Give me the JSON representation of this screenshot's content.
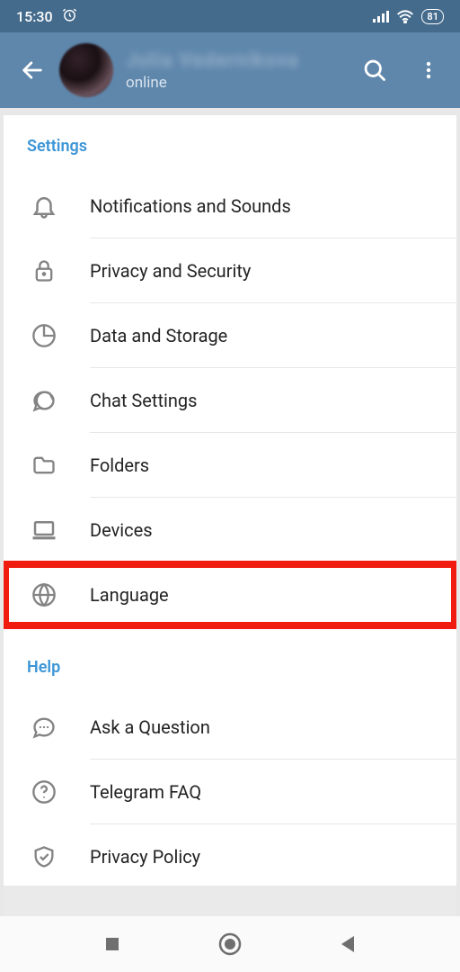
{
  "status": {
    "time": "15:30",
    "battery": "81"
  },
  "header": {
    "name": "Julia Vedernikova",
    "status": "online"
  },
  "sections": {
    "settings": {
      "title": "Settings",
      "items": [
        {
          "label": "Notifications and Sounds"
        },
        {
          "label": "Privacy and Security"
        },
        {
          "label": "Data and Storage"
        },
        {
          "label": "Chat Settings"
        },
        {
          "label": "Folders"
        },
        {
          "label": "Devices"
        },
        {
          "label": "Language"
        }
      ]
    },
    "help": {
      "title": "Help",
      "items": [
        {
          "label": "Ask a Question"
        },
        {
          "label": "Telegram FAQ"
        },
        {
          "label": "Privacy Policy"
        }
      ]
    }
  }
}
